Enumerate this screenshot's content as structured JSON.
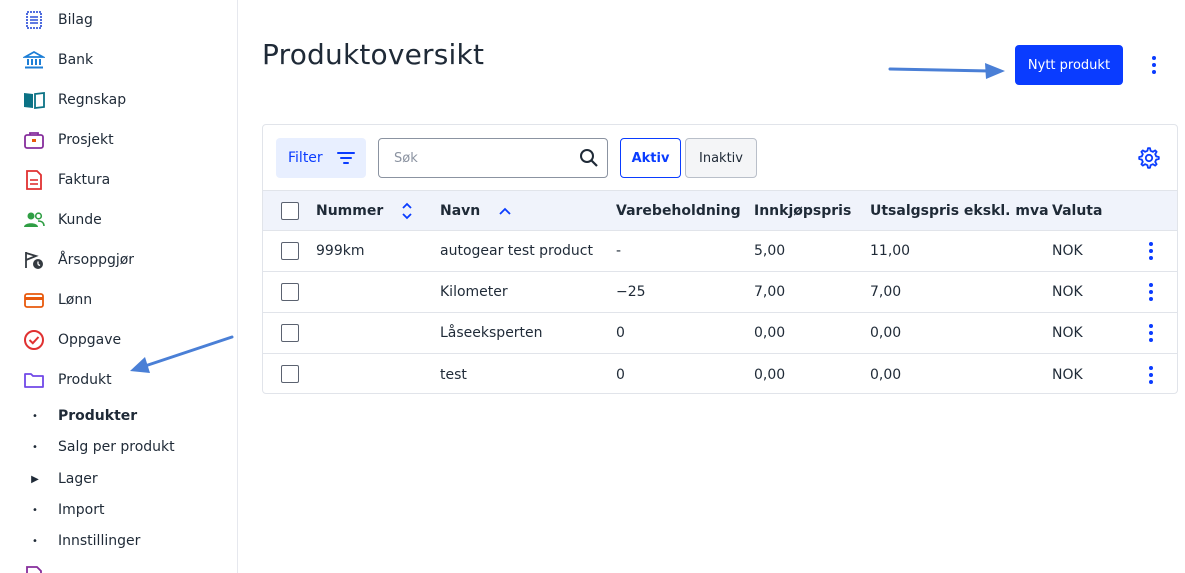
{
  "sidebar": {
    "items": [
      {
        "label": "Bilag",
        "icon": "receipt-icon",
        "color": "#3b5bdb"
      },
      {
        "label": "Bank",
        "icon": "bank-icon",
        "color": "#1c7ed6"
      },
      {
        "label": "Regnskap",
        "icon": "book-icon",
        "color": "#0b7285"
      },
      {
        "label": "Prosjekt",
        "icon": "briefcase-icon",
        "color": "#862e9c"
      },
      {
        "label": "Faktura",
        "icon": "invoice-icon",
        "color": "#e03131"
      },
      {
        "label": "Kunde",
        "icon": "people-icon",
        "color": "#2f9e44"
      },
      {
        "label": "Årsoppgjør",
        "icon": "flag-clock-icon",
        "color": "#343a40"
      },
      {
        "label": "Lønn",
        "icon": "card-icon",
        "color": "#e8590c"
      },
      {
        "label": "Oppgave",
        "icon": "check-circle-icon",
        "color": "#e03131"
      },
      {
        "label": "Produkt",
        "icon": "folder-icon",
        "color": "#7048e8"
      }
    ],
    "sub_items": [
      {
        "label": "Produkter",
        "bullet": "•",
        "active": true
      },
      {
        "label": "Salg per produkt",
        "bullet": "•"
      },
      {
        "label": "Lager",
        "bullet": "▶"
      },
      {
        "label": "Import",
        "bullet": "•"
      },
      {
        "label": "Innstillinger",
        "bullet": "•"
      }
    ]
  },
  "page": {
    "title": "Produktoversikt",
    "new_button": "Nytt produkt"
  },
  "toolbar": {
    "filter_label": "Filter",
    "search_placeholder": "Søk",
    "aktiv_label": "Aktiv",
    "inaktiv_label": "Inaktiv"
  },
  "table": {
    "headers": {
      "number": "Nummer",
      "name": "Navn",
      "stock": "Varebeholdning",
      "purchase_price": "Innkjøpspris",
      "sale_price": "Utsalgspris ekskl. mva",
      "currency": "Valuta"
    },
    "rows": [
      {
        "number": "999km",
        "name": "autogear test product",
        "stock": "-",
        "purchase_price": "5,00",
        "sale_price": "11,00",
        "currency": "NOK"
      },
      {
        "number": "",
        "name": "Kilometer",
        "stock": "−25",
        "purchase_price": "7,00",
        "sale_price": "7,00",
        "currency": "NOK"
      },
      {
        "number": "",
        "name": "Låseeksperten",
        "stock": "0",
        "purchase_price": "0,00",
        "sale_price": "0,00",
        "currency": "NOK"
      },
      {
        "number": "",
        "name": "test",
        "stock": "0",
        "purchase_price": "0,00",
        "sale_price": "0,00",
        "currency": "NOK"
      }
    ]
  },
  "colors": {
    "accent": "#0a3cff",
    "annotation_arrow": "#4a7fd6"
  }
}
